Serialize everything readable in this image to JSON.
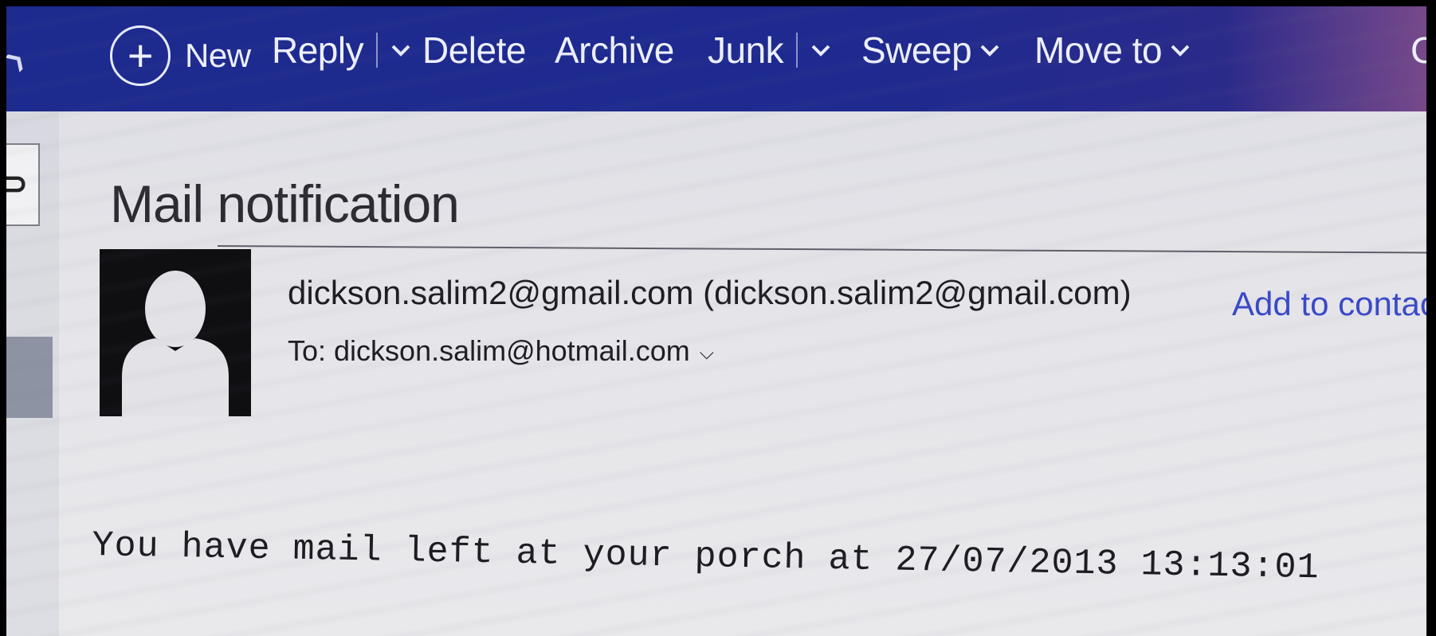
{
  "toolbar": {
    "new_label": "New",
    "reply_label": "Reply",
    "delete_label": "Delete",
    "archive_label": "Archive",
    "junk_label": "Junk",
    "sweep_label": "Sweep",
    "move_to_label": "Move to",
    "cut_off_label": "C"
  },
  "message": {
    "subject": "Mail notification",
    "from": "dickson.salim2@gmail.com (dickson.salim2@gmail.com)",
    "add_contact_label": "Add to contac",
    "to": "To: dickson.salim@hotmail.com",
    "body": "You have mail left at your porch at 27/07/2013 13:13:01"
  },
  "colors": {
    "toolbar_bg": "#1d2a8e",
    "link": "#3949c9"
  },
  "icons": {
    "new": "plus-circle-icon",
    "dropdown": "chevron-down-icon",
    "avatar": "person-silhouette-icon",
    "expand": "expand-recipients-icon"
  }
}
